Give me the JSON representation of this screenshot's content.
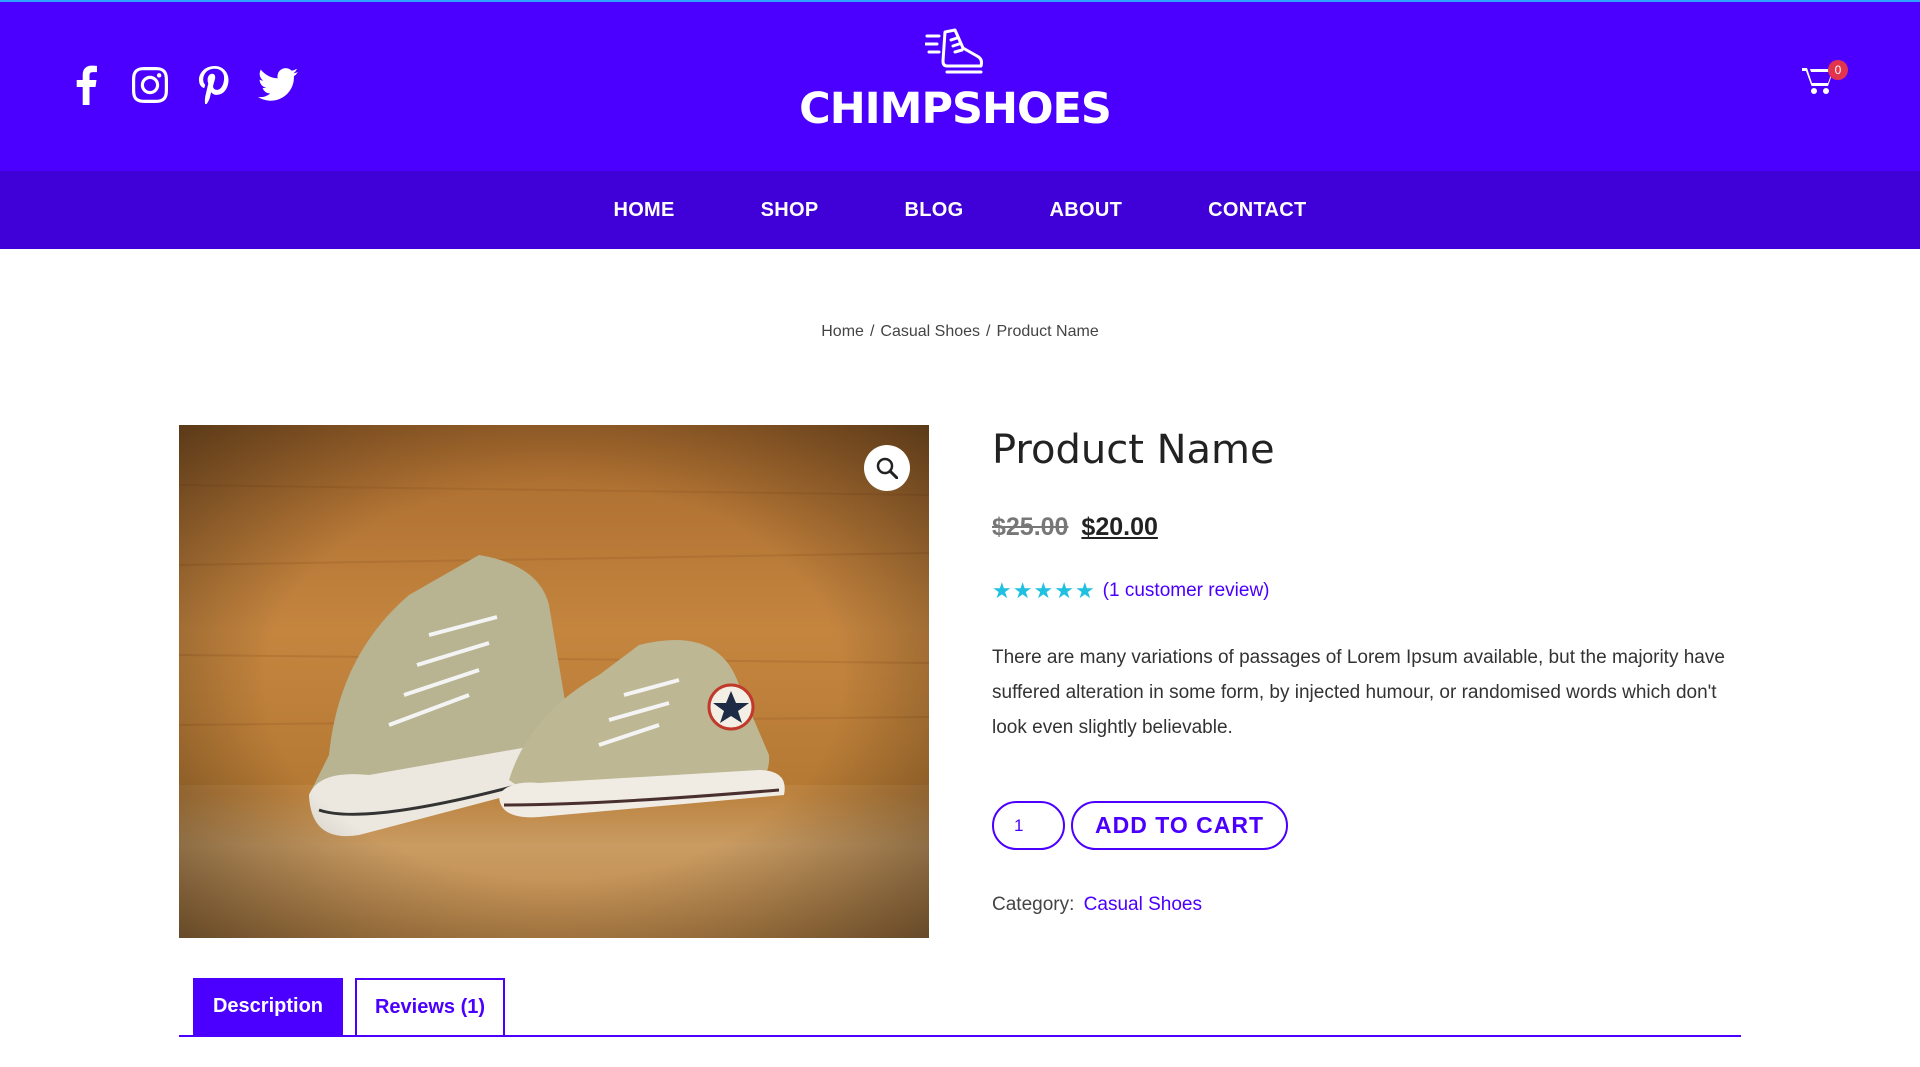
{
  "header": {
    "brand_name": "CHIMPSHOES",
    "brand_icon": "running-shoe-icon",
    "socials": [
      "facebook-icon",
      "instagram-icon",
      "pinterest-icon",
      "twitter-icon"
    ],
    "cart_count": "0",
    "colors": {
      "header_bg": "#4b00ff",
      "nav_bg": "#4000d8",
      "badge": "#e2344d"
    }
  },
  "nav": {
    "items": [
      "HOME",
      "SHOP",
      "BLOG",
      "ABOUT",
      "CONTACT"
    ]
  },
  "breadcrumb": {
    "home": "Home",
    "category": "Casual Shoes",
    "current": "Product Name",
    "separator": "/"
  },
  "product": {
    "title": "Product Name",
    "price_old": "$25.00",
    "price_new": "$20.00",
    "rating": 5,
    "rating_max": 5,
    "review_link": "(1 customer review)",
    "description": "There are many variations of passages of Lorem Ipsum available, but the majority have suffered alteration in some form, by injected humour, or randomised words which don't look even slightly believable.",
    "quantity": "1",
    "add_to_cart_label": "ADD TO CART",
    "category_label": "Category:",
    "category_value": "Casual Shoes",
    "accent_color": "#4b00ff",
    "star_color": "#1fc0e0"
  },
  "tabs": [
    {
      "label": "Description",
      "active": true
    },
    {
      "label": "Reviews (1)",
      "active": false
    }
  ]
}
